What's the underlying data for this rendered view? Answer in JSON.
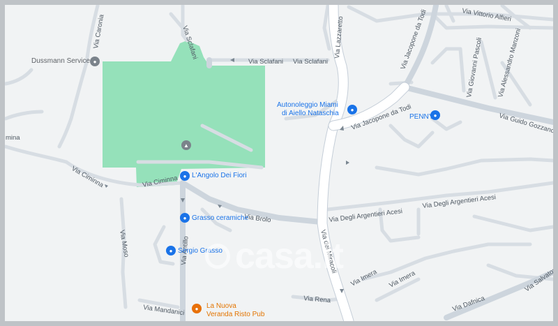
{
  "streets": {
    "via_sclafani_h": "Via Sclafani",
    "via_sclafani_h2": "Via Sclafani",
    "via_sclafani_v": "Via Sclafani",
    "via_caronia": "Via Caronia",
    "via_lazzaretto": "Via Lazzaretto",
    "via_jacopone_1": "Via Jacopone da Todi",
    "via_jacopone_2": "Via Jacopone da Todi",
    "via_vittorio_alfieri": "Via Vittorio Alfieri",
    "via_giovanni_pascoli": "Via Giovanni Pascoli",
    "via_alessandro_manzoni": "Via Alessandro Manzoni",
    "via_guido_gozzano": "Via Guido Gozzano",
    "via_ciminna_1": "Via Ciminna",
    "via_ciminna_2": "Via Ciminna",
    "via_brolo": "Via Brolo",
    "via_degli_argentieri_1": "Via Degli Argentieri Acesi",
    "via_degli_argentieri_2": "Via Degli Argentieri Acesi",
    "via_dei_miracoli": "Via dei Miracoli",
    "via_antillo": "Via Antillo",
    "via_moso": "Via Moso",
    "via_mandanici": "Via Mandanici",
    "via_rena": "Via Rena",
    "via_imera_1": "Via Imera",
    "via_imera_2": "Via Imera",
    "via_dafnica": "Via Dafnica",
    "via_salvatore": "Via Salvator",
    "cut_mina": "mina"
  },
  "pois": {
    "dussmann": "Dussmann Service",
    "autonoleggio_line1": "Autonoleggio Miami",
    "autonoleggio_line2": "di Aiello Nataschia",
    "penny": "PENNY",
    "angolo": "L'Angolo Dei Fiori",
    "grasso_ceramiche": "Grasso ceramiche",
    "sergio_grasso": "Sergio Grasso",
    "nuova_veranda_line1": "La Nuova",
    "nuova_veranda_line2": "Veranda Risto Pub"
  },
  "watermark": "casa.it",
  "colors": {
    "park": "#95e1ba",
    "poi_blue": "#1a73e8",
    "poi_orange": "#e37400",
    "background": "#f1f3f4"
  }
}
